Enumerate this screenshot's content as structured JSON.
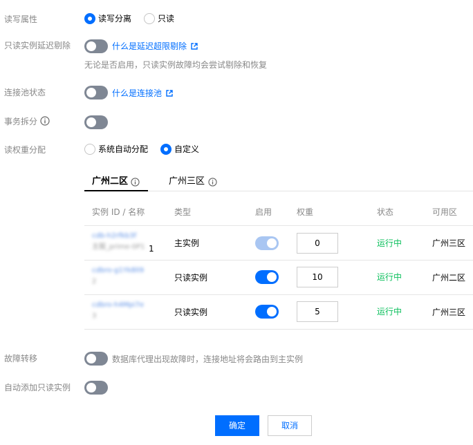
{
  "form": {
    "rw_attr": {
      "label": "读写属性",
      "options": [
        "读写分离",
        "只读"
      ],
      "selected": "读写分离"
    },
    "ro_delay": {
      "label": "只读实例延迟剔除",
      "link": "什么是延迟超限剔除",
      "hint": "无论是否启用，只读实例故障均会尝试剔除和恢复",
      "enabled": false
    },
    "pool": {
      "label": "连接池状态",
      "link": "什么是连接池",
      "enabled": false
    },
    "txn_split": {
      "label": "事务拆分",
      "enabled": false
    },
    "weight_alloc": {
      "label": "读权重分配",
      "options": [
        "系统自动分配",
        "自定义"
      ],
      "selected": "自定义"
    },
    "failover": {
      "label": "故障转移",
      "hint": "数据库代理出现故障时，连接地址将会路由到主实例",
      "enabled": false
    },
    "auto_add_ro": {
      "label": "自动添加只读实例",
      "enabled": false
    }
  },
  "tabs": [
    {
      "label": "广州二区",
      "active": true
    },
    {
      "label": "广州三区",
      "active": false
    }
  ],
  "table": {
    "headers": [
      "实例 ID / 名称",
      "类型",
      "启用",
      "权重",
      "状态",
      "可用区"
    ],
    "rows": [
      {
        "id": "cdb-h2rfkb3f",
        "name": "主服_prime-0P1",
        "suffix": "1",
        "type": "主实例",
        "enabled": true,
        "disabled": true,
        "weight": "0",
        "status": "运行中",
        "zone": "广州三区"
      },
      {
        "id": "cdbro-g1Yk8lI9",
        "name": "2",
        "suffix": "",
        "type": "只读实例",
        "enabled": true,
        "disabled": false,
        "weight": "10",
        "status": "运行中",
        "zone": "广州二区"
      },
      {
        "id": "cdbro-h4Mpi7e",
        "name": "3",
        "suffix": "",
        "type": "只读实例",
        "enabled": true,
        "disabled": false,
        "weight": "5",
        "status": "运行中",
        "zone": "广州三区"
      }
    ]
  },
  "buttons": {
    "ok": "确定",
    "cancel": "取消"
  },
  "colors": {
    "primary": "#006eff",
    "success": "#0abf5b",
    "toggle_off": "#7f8794",
    "label": "#888888"
  },
  "icons": [
    "external-link-icon",
    "info-circle-icon"
  ]
}
